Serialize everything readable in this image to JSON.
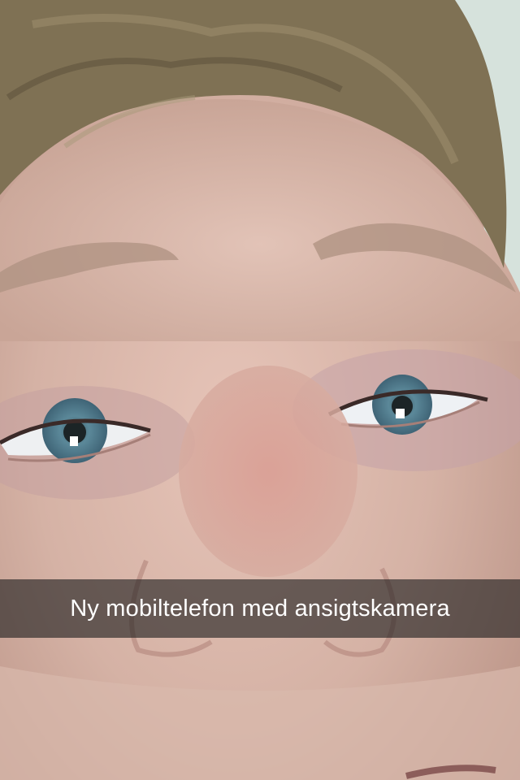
{
  "snap": {
    "caption": "Ny mobiltelefon med ansigtskamera"
  },
  "photo": {
    "subject_icon": "face-photo",
    "eye_color": "#5d8aa0",
    "hair_color": "#7f7154",
    "skin_color": "#d8b4a6"
  }
}
